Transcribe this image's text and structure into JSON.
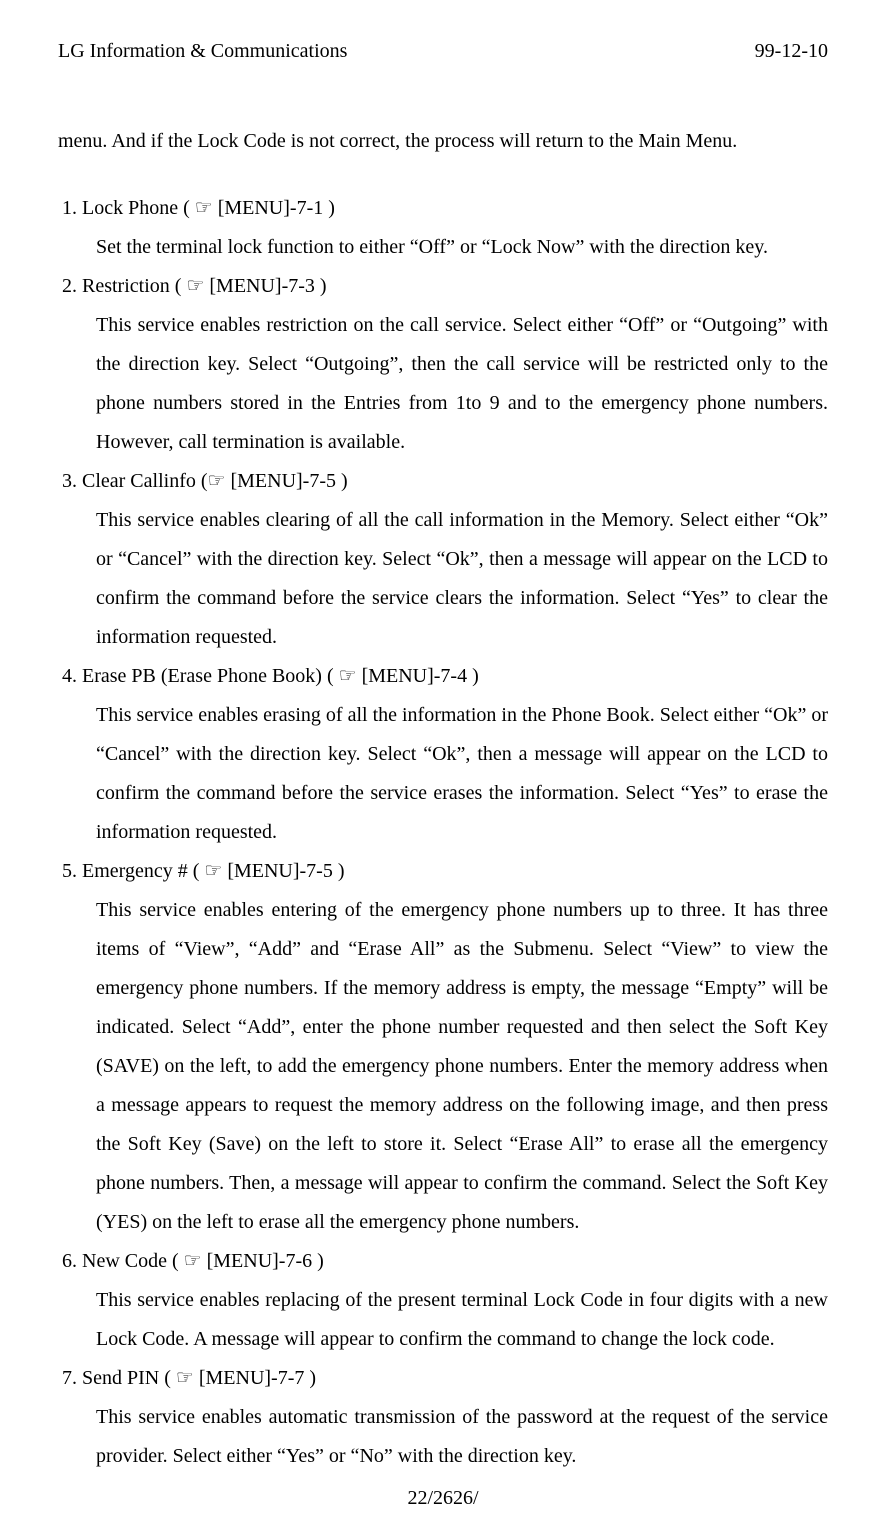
{
  "header": {
    "left": "LG Information & Communications",
    "right": "99-12-10"
  },
  "intro": "menu. And if the Lock Code is not correct, the process will return to the Main Menu.",
  "ptr_glyph": "☞",
  "items": [
    {
      "num": "1.",
      "title": "Lock Phone",
      "menu": "[MENU]-7-1",
      "body": "Set the terminal lock function to either “Off” or “Lock Now” with the direction key."
    },
    {
      "num": "2.",
      "title": "Restriction",
      "menu": "[MENU]-7-3",
      "body": "This service enables restriction on the call service. Select either “Off” or “Outgoing” with the direction key. Select “Outgoing”, then the call service will be restricted only to the phone numbers stored in the Entries from 1to 9 and to the emergency phone numbers. However, call termination is available."
    },
    {
      "num": "3.",
      "title": "Clear Callinfo",
      "menu": "[MENU]-7-5",
      "body": "This service enables clearing of all the call information in the Memory. Select either “Ok” or “Cancel” with the direction key. Select “Ok”, then a message will appear on the LCD to confirm the command before the service clears the information. Select “Yes” to clear the information requested."
    },
    {
      "num": "4.",
      "title": "Erase PB (Erase Phone Book)",
      "menu": "[MENU]-7-4",
      "body": "This service enables erasing of all the information in the Phone Book. Select either “Ok” or “Cancel” with the direction key. Select “Ok”, then a message will appear on the LCD to confirm the command before the service erases the information. Select “Yes” to erase the information requested."
    },
    {
      "num": "5.",
      "title": "Emergency #",
      "menu": "[MENU]-7-5",
      "body": "This service enables entering of the emergency phone numbers up to three.\nIt has three items of “View”, “Add” and “Erase All” as the Submenu. Select “View” to view the emergency phone numbers. If the memory address is empty, the message “Empty” will be indicated. Select “Add”, enter the phone number requested and then select the Soft Key (SAVE) on the left, to add the emergency phone numbers. Enter the memory address when a message appears to request the memory address on the following image, and then press the Soft Key (Save) on the left to store it. Select “Erase All” to erase all the emergency phone numbers. Then, a message will appear to confirm the command. Select the Soft Key (YES) on the left to erase all the emergency phone numbers."
    },
    {
      "num": "6.",
      "title": "New Code",
      "menu": "[MENU]-7-6",
      "body": "This service enables replacing of the present terminal Lock Code in four digits with a new Lock Code. A message will appear to confirm the command to change the lock code."
    },
    {
      "num": "7.",
      "title": "Send PIN",
      "menu": "[MENU]-7-7",
      "body": "This service enables automatic transmission of the password at the request of the service provider. Select either “Yes” or “No” with the direction key."
    }
  ],
  "footer": "22/2626/"
}
